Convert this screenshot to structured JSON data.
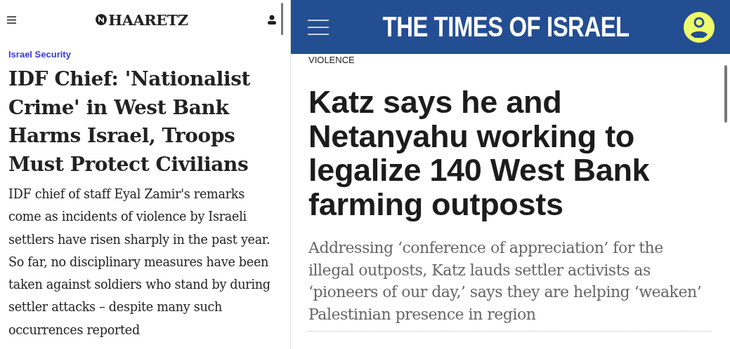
{
  "left_article": {
    "logo": "HAARETZ",
    "category": "Israel Security",
    "headline": "IDF Chief: 'Nationalist Crime' in West Bank Harms Israel, Troops Must Protect Civilians",
    "summary": "IDF chief of staff Eyal Zamir's remarks come as incidents of violence by Israeli settlers have risen sharply in the past year. So far, no disciplinary measures have been taken against soldiers who stand by during settler attacks – despite many such occurrences reported"
  },
  "right_article": {
    "logo": "THE TIMES OF ISRAEL",
    "category": "VIOLENCE",
    "headline": "Katz says he and Netanyahu working to legalize 140 West Bank farming outposts",
    "summary": "Addressing ‘conference of appreciation’ for the illegal outposts, Katz lauds settler activists as ‘pioneers of our day,’ says they are helping ‘weaken’ Palestinian presence in region"
  }
}
